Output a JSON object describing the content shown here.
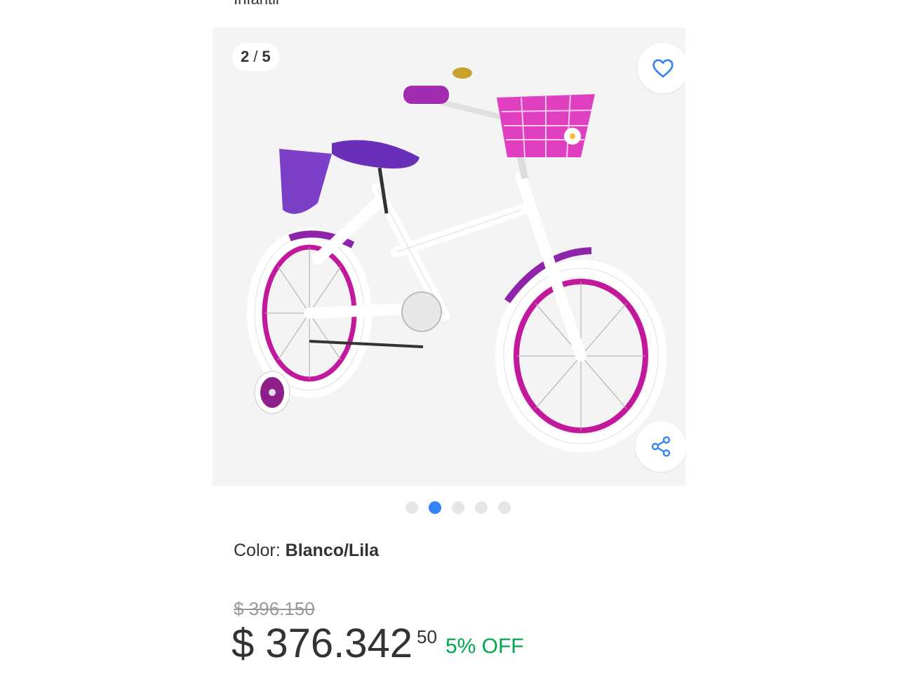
{
  "product": {
    "title_fragment": "Infantil"
  },
  "gallery": {
    "current": "2",
    "separator": "/",
    "total": "5",
    "active_index": 1,
    "dot_count": 5
  },
  "icons": {
    "favorite": "heart-outline-icon",
    "share": "share-icon"
  },
  "color": {
    "label": "Color:",
    "value": "Blanco/Lila"
  },
  "pricing": {
    "original_price": "$ 396.150",
    "price": "$ 376.342",
    "cents": "50",
    "discount": "5% OFF"
  },
  "colors": {
    "accent": "#3483fa",
    "discount": "#00a650",
    "bike_magenta": "#c2189b",
    "bike_purple": "#6a2fb8"
  }
}
